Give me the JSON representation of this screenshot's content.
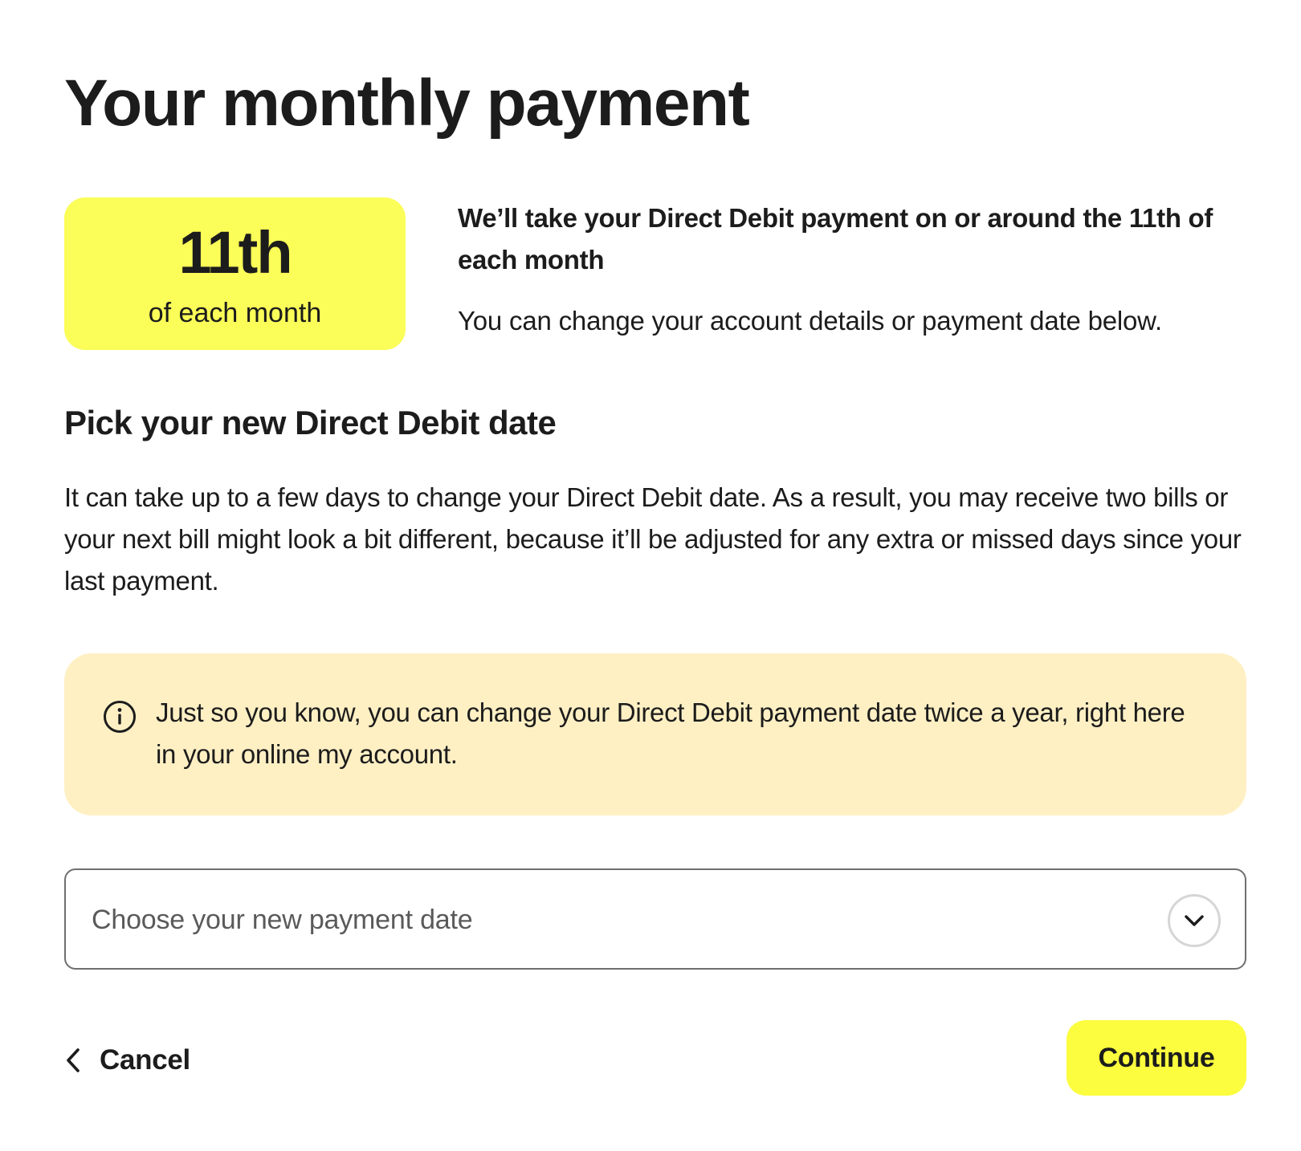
{
  "page": {
    "title": "Your monthly payment"
  },
  "payment_card": {
    "day": "11th",
    "sub": "of each month",
    "color": "#fbfd58"
  },
  "payment_info": {
    "lead": "We’ll take your Direct Debit payment on or around the 11th of each month",
    "note": "You can change your account details or payment date below."
  },
  "section": {
    "title": "Pick your new Direct Debit date",
    "body": "It can take up to a few days to change your Direct Debit date. As a result, you may receive two bills or your next bill might look a bit different, because it’ll be adjusted for any extra or missed days since your last payment."
  },
  "notice": {
    "icon": "info-icon",
    "text": "Just so you know, you can change your Direct Debit payment date twice a year, right here in your online my account.",
    "color": "#fff0c4"
  },
  "date_select": {
    "placeholder": "Choose your new payment date",
    "icon": "chevron-down-icon"
  },
  "actions": {
    "cancel_icon": "chevron-left-icon",
    "cancel_label": "Cancel",
    "continue_label": "Continue",
    "continue_color": "#fbfd3e"
  }
}
